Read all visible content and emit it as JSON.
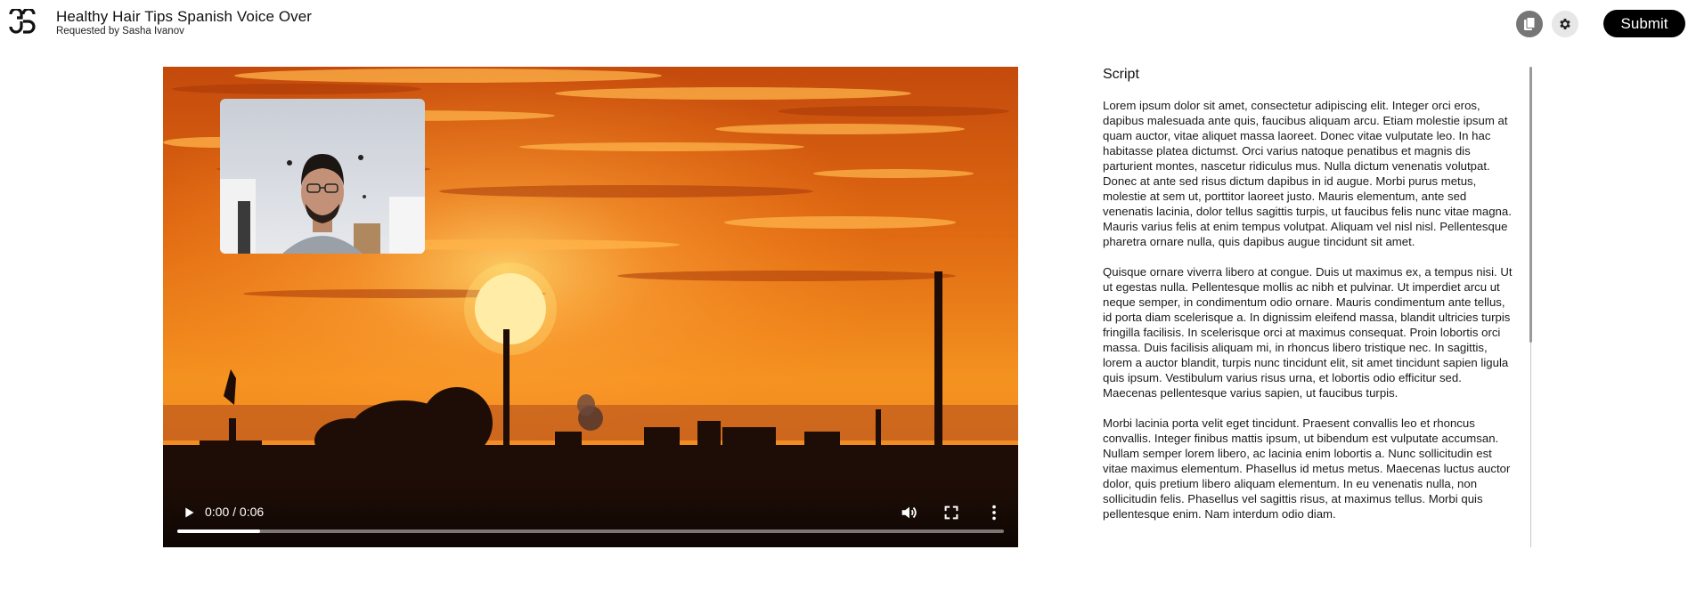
{
  "header": {
    "title": "Healthy Hair Tips Spanish Voice Over",
    "subtitle": "Requested by Sasha Ivanov",
    "submit_label": "Submit",
    "icons": [
      "logo-icon",
      "copy-icon",
      "gear-icon"
    ]
  },
  "video": {
    "time_display": "0:00 / 0:06",
    "progress": 0.1
  },
  "script": {
    "heading": "Script",
    "paragraphs": [
      "Lorem ipsum dolor sit amet, consectetur adipiscing elit. Integer orci eros, dapibus malesuada ante quis, faucibus aliquam arcu. Etiam molestie ipsum at quam auctor, vitae aliquet massa laoreet. Donec vitae vulputate leo. In hac habitasse platea dictumst. Orci varius natoque penatibus et magnis dis parturient montes, nascetur ridiculus mus. Nulla dictum venenatis volutpat. Donec at ante sed risus dictum dapibus in id augue. Morbi purus metus, molestie at sem ut, porttitor laoreet justo. Mauris elementum, ante sed venenatis lacinia, dolor tellus sagittis turpis, ut faucibus felis nunc vitae magna. Mauris varius felis at enim tempus volutpat. Aliquam vel nisl nisl. Pellentesque pharetra ornare nulla, quis dapibus augue tincidunt sit amet.",
      "Quisque ornare viverra libero at congue. Duis ut maximus ex, a tempus nisi. Ut ut egestas nulla. Pellentesque mollis ac nibh et pulvinar. Ut imperdiet arcu ut neque semper, in condimentum odio ornare. Mauris condimentum ante tellus, id porta diam scelerisque a. In dignissim eleifend massa, blandit ultricies turpis fringilla facilisis. In scelerisque orci at maximus consequat. Proin lobortis orci massa. Duis facilisis aliquam mi, in rhoncus libero tristique nec. In sagittis, lorem a auctor blandit, turpis nunc tincidunt elit, sit amet tincidunt sapien ligula quis ipsum. Vestibulum varius risus urna, et lobortis odio efficitur sed. Maecenas pellentesque varius sapien, ut faucibus turpis.",
      "Morbi lacinia porta velit eget tincidunt. Praesent convallis leo et rhoncus convallis. Integer finibus mattis ipsum, ut bibendum est vulputate accumsan. Nullam semper lorem libero, ac lacinia enim lobortis a. Nunc sollicitudin est vitae maximus elementum. Phasellus id metus metus. Maecenas luctus auctor dolor, quis pretium libero aliquam elementum. In eu venenatis nulla, non sollicitudin felis. Phasellus vel sagittis risus, at maximus tellus. Morbi quis pellentesque enim. Nam interdum odio diam."
    ]
  },
  "colors": {
    "accent": "#000000",
    "sky_top": "#d2560e",
    "sky_mid": "#f08a1c",
    "sun": "#fff6c8"
  }
}
